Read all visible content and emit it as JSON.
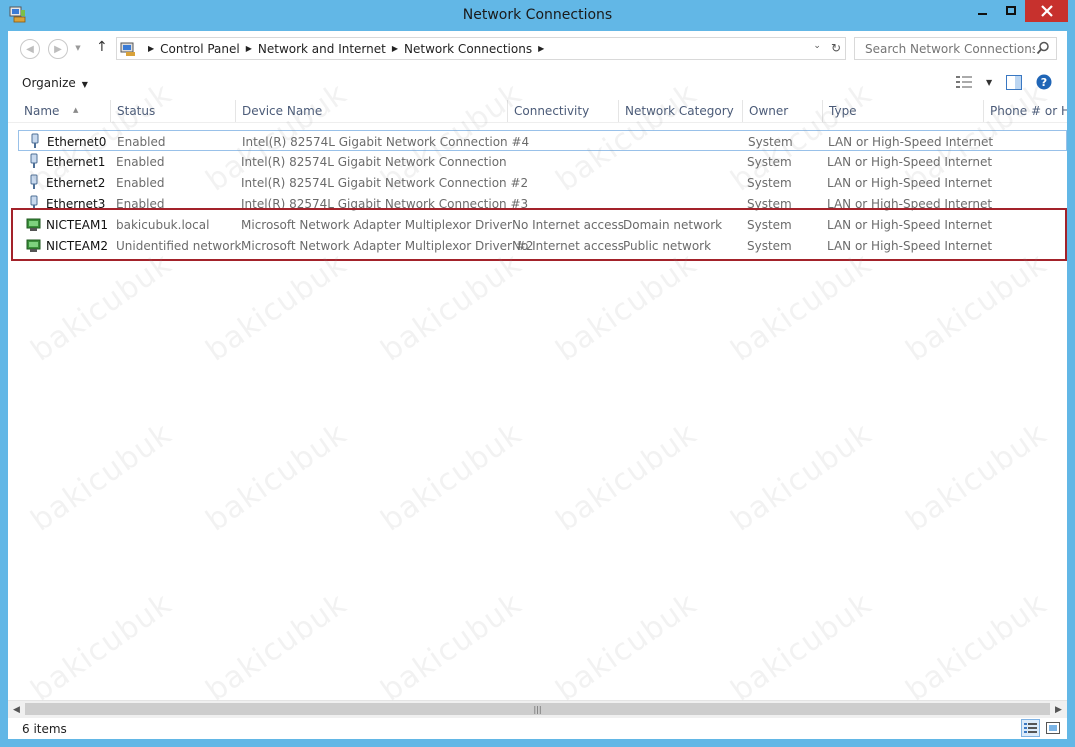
{
  "window": {
    "title": "Network Connections",
    "accent": "#62b7e6",
    "close_color": "#c7312d"
  },
  "address": {
    "crumbs": [
      "Control Panel",
      "Network and Internet",
      "Network Connections"
    ]
  },
  "search": {
    "placeholder": "Search Network Connections"
  },
  "toolbar": {
    "organize_label": "Organize"
  },
  "columns": [
    "Name",
    "Status",
    "Device Name",
    "Connectivity",
    "Network Category",
    "Owner",
    "Type",
    "Phone # or Ho"
  ],
  "rows": [
    {
      "name": "Ethernet0",
      "status": "Enabled",
      "device": "Intel(R) 82574L Gigabit Network Connection #4",
      "connectivity": "",
      "category": "",
      "owner": "System",
      "type": "LAN or High-Speed Internet",
      "icon": "ethernet-icon"
    },
    {
      "name": "Ethernet1",
      "status": "Enabled",
      "device": "Intel(R) 82574L Gigabit Network Connection",
      "connectivity": "",
      "category": "",
      "owner": "System",
      "type": "LAN or High-Speed Internet",
      "icon": "ethernet-icon"
    },
    {
      "name": "Ethernet2",
      "status": "Enabled",
      "device": "Intel(R) 82574L Gigabit Network Connection #2",
      "connectivity": "",
      "category": "",
      "owner": "System",
      "type": "LAN or High-Speed Internet",
      "icon": "ethernet-icon"
    },
    {
      "name": "Ethernet3",
      "status": "Enabled",
      "device": "Intel(R) 82574L Gigabit Network Connection #3",
      "connectivity": "",
      "category": "",
      "owner": "System",
      "type": "LAN or High-Speed Internet",
      "icon": "ethernet-icon"
    },
    {
      "name": "NICTEAM1",
      "status": "bakicubuk.local",
      "device": "Microsoft Network Adapter Multiplexor Driver",
      "connectivity": "No Internet access",
      "category": "Domain network",
      "owner": "System",
      "type": "LAN or High-Speed Internet",
      "icon": "network-connected-icon"
    },
    {
      "name": "NICTEAM2",
      "status": "Unidentified network",
      "device": "Microsoft Network Adapter Multiplexor Driver #2",
      "connectivity": "No Internet access",
      "category": "Public network",
      "owner": "System",
      "type": "LAN or High-Speed Internet",
      "icon": "network-connected-icon"
    }
  ],
  "status": {
    "items_count": "6 items"
  },
  "watermark": "bakicubuk"
}
